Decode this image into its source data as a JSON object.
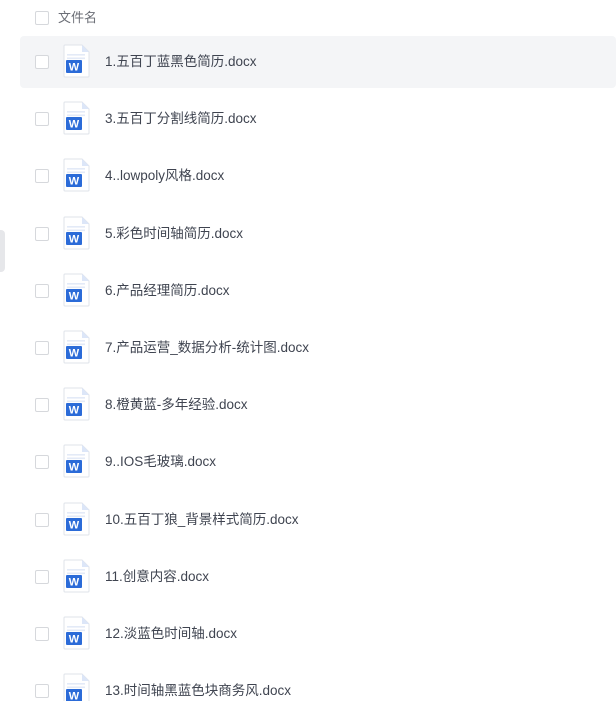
{
  "header": {
    "column_label": "文件名"
  },
  "files": [
    {
      "name": "1.五百丁蓝黑色简历.docx",
      "icon": "word-doc-icon",
      "highlighted": true
    },
    {
      "name": "3.五百丁分割线简历.docx",
      "icon": "word-doc-icon"
    },
    {
      "name": "4..lowpoly风格.docx",
      "icon": "word-doc-icon"
    },
    {
      "name": "5.彩色时间轴简历.docx",
      "icon": "word-doc-icon"
    },
    {
      "name": "6.产品经理简历.docx",
      "icon": "word-doc-icon"
    },
    {
      "name": "7.产品运营_数据分析-统计图.docx",
      "icon": "word-doc-icon"
    },
    {
      "name": "8.橙黄蓝-多年经验.docx",
      "icon": "word-doc-icon"
    },
    {
      "name": "9..IOS毛玻璃.docx",
      "icon": "word-doc-icon"
    },
    {
      "name": "10.五百丁狼_背景样式简历.docx",
      "icon": "word-doc-icon"
    },
    {
      "name": "11.创意内容.docx",
      "icon": "word-doc-icon"
    },
    {
      "name": "12.淡蓝色时间轴.docx",
      "icon": "word-doc-icon"
    },
    {
      "name": "13.时间轴黑蓝色块商务风.docx",
      "icon": "word-doc-icon"
    }
  ],
  "colors": {
    "word_blue": "#2b6bd8",
    "word_fold": "#a9c3f2",
    "row_hover_bg": "#f4f5f7",
    "text": "#3f4450"
  }
}
